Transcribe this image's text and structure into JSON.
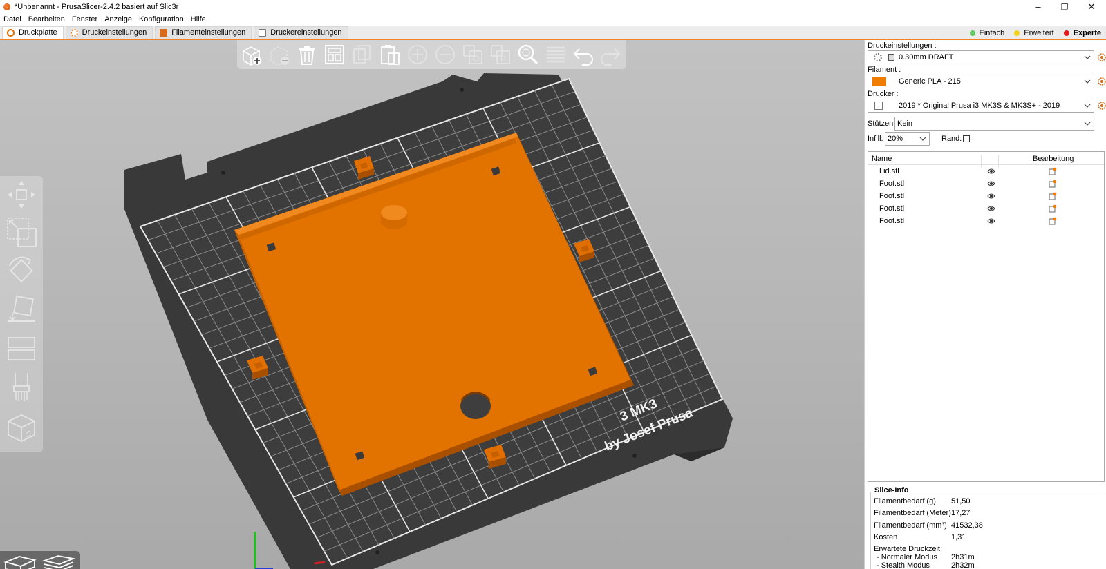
{
  "window": {
    "title": "*Unbenannt - PrusaSlicer-2.4.2 basiert auf Slic3r",
    "minimize": "–",
    "maximize": "❐",
    "close": "✕"
  },
  "menu": {
    "items": [
      "Datei",
      "Bearbeiten",
      "Fenster",
      "Anzeige",
      "Konfiguration",
      "Hilfe"
    ]
  },
  "tabs": [
    {
      "label": "Druckplatte",
      "icon": "plater-icon",
      "active": true
    },
    {
      "label": "Druckeinstellungen",
      "icon": "cog-icon"
    },
    {
      "label": "Filamenteinstellungen",
      "icon": "spool-icon"
    },
    {
      "label": "Druckereinstellungen",
      "icon": "printer-icon"
    }
  ],
  "modes": [
    {
      "label": "Einfach",
      "color": "#5fc85f"
    },
    {
      "label": "Erweitert",
      "color": "#f2d21b"
    },
    {
      "label": "Experte",
      "color": "#e11b1b",
      "active": true
    }
  ],
  "viewport": {
    "bed_label_line1": "3 MK3",
    "bed_label_line2": "by Josef Prusa",
    "model_color": "#e06e00",
    "bed_color": "#3a3a3a"
  },
  "top_toolbar": {
    "buttons": [
      "add-icon",
      "delete-icon",
      "delete-all-icon",
      "arrange-icon",
      "copy-icon",
      "paste-icon",
      "add-instance-icon",
      "remove-instance-icon",
      "split-objects-icon",
      "split-parts-icon",
      "search-icon",
      "layers-editing-icon",
      "undo-icon",
      "redo-icon"
    ]
  },
  "panel": {
    "print_settings_label": "Druckeinstellungen :",
    "print_settings_value": "0.30mm DRAFT",
    "filament_label": "Filament :",
    "filament_value": "Generic PLA - 215",
    "filament_color": "#f07d00",
    "printer_label": "Drucker :",
    "printer_value": "2019 * Original Prusa i3 MK3S & MK3S+ - 2019",
    "supports_label": "Stützen:",
    "supports_value": "Kein",
    "infill_label": "Infill:",
    "infill_value": "20%",
    "brim_label": "Rand:"
  },
  "object_list": {
    "col_name": "Name",
    "col_edit": "Bearbeitung",
    "objects": [
      "Lid.stl",
      "Foot.stl",
      "Foot.stl",
      "Foot.stl",
      "Foot.stl"
    ]
  },
  "slice_info": {
    "title": "Slice-Info",
    "rows": [
      {
        "key": "Filamentbedarf (g)",
        "value": "51,50"
      },
      {
        "key": "Filamentbedarf (Meter)",
        "value": "17,27"
      },
      {
        "key": "Filamentbedarf (mm³)",
        "value": "41532,38"
      },
      {
        "key": "Kosten",
        "value": "1,31"
      },
      {
        "key": "Erwartete Druckzeit:",
        "value": ""
      },
      {
        "key": "- Normaler Modus",
        "value": "2h31m"
      },
      {
        "key": "- Stealth Modus",
        "value": "2h32m"
      }
    ]
  }
}
